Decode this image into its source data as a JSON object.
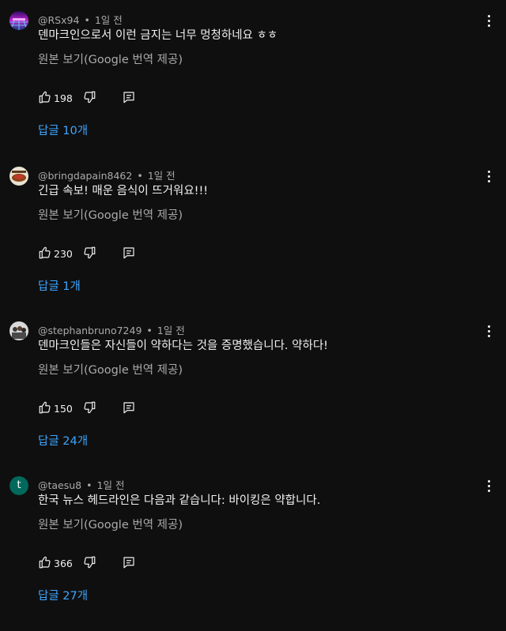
{
  "comments": [
    {
      "handle": "@RSx94",
      "time": "1일 전",
      "text": "덴마크인으로서 이런 금지는 너무 멍청하네요 ㅎㅎ",
      "translate_label": "원본 보기(Google 번역 제공)",
      "likes": "198",
      "replies_label": "답글 10개",
      "avatar_icon": "synthwave-grid-avatar"
    },
    {
      "handle": "@bringdapain8462",
      "time": "1일 전",
      "text": "긴급 속보! 매운 음식이 뜨거워요!!!",
      "translate_label": "원본 보기(Google 번역 제공)",
      "likes": "230",
      "replies_label": "답글 1개",
      "avatar_icon": "food-photo-avatar"
    },
    {
      "handle": "@stephanbruno7249",
      "time": "1일 전",
      "text": "덴마크인들은 자신들이 약하다는 것을 증명했습니다. 약하다!",
      "translate_label": "원본 보기(Google 번역 제공)",
      "likes": "150",
      "replies_label": "답글 24개",
      "avatar_icon": "group-photo-avatar"
    },
    {
      "handle": "@taesu8",
      "time": "1일 전",
      "text": "한국 뉴스 헤드라인은 다음과 같습니다: 바이킹은 약합니다.",
      "translate_label": "원본 보기(Google 번역 제공)",
      "likes": "366",
      "replies_label": "답글 27개",
      "avatar_letter": "t",
      "avatar_icon": "letter-avatar"
    }
  ],
  "colors": {
    "background": "#0f0f0f",
    "text": "#f1f1f1",
    "secondary": "#aaaaaa",
    "link": "#3ea6ff",
    "letter_avatar": "#00695c"
  },
  "separator": "•"
}
